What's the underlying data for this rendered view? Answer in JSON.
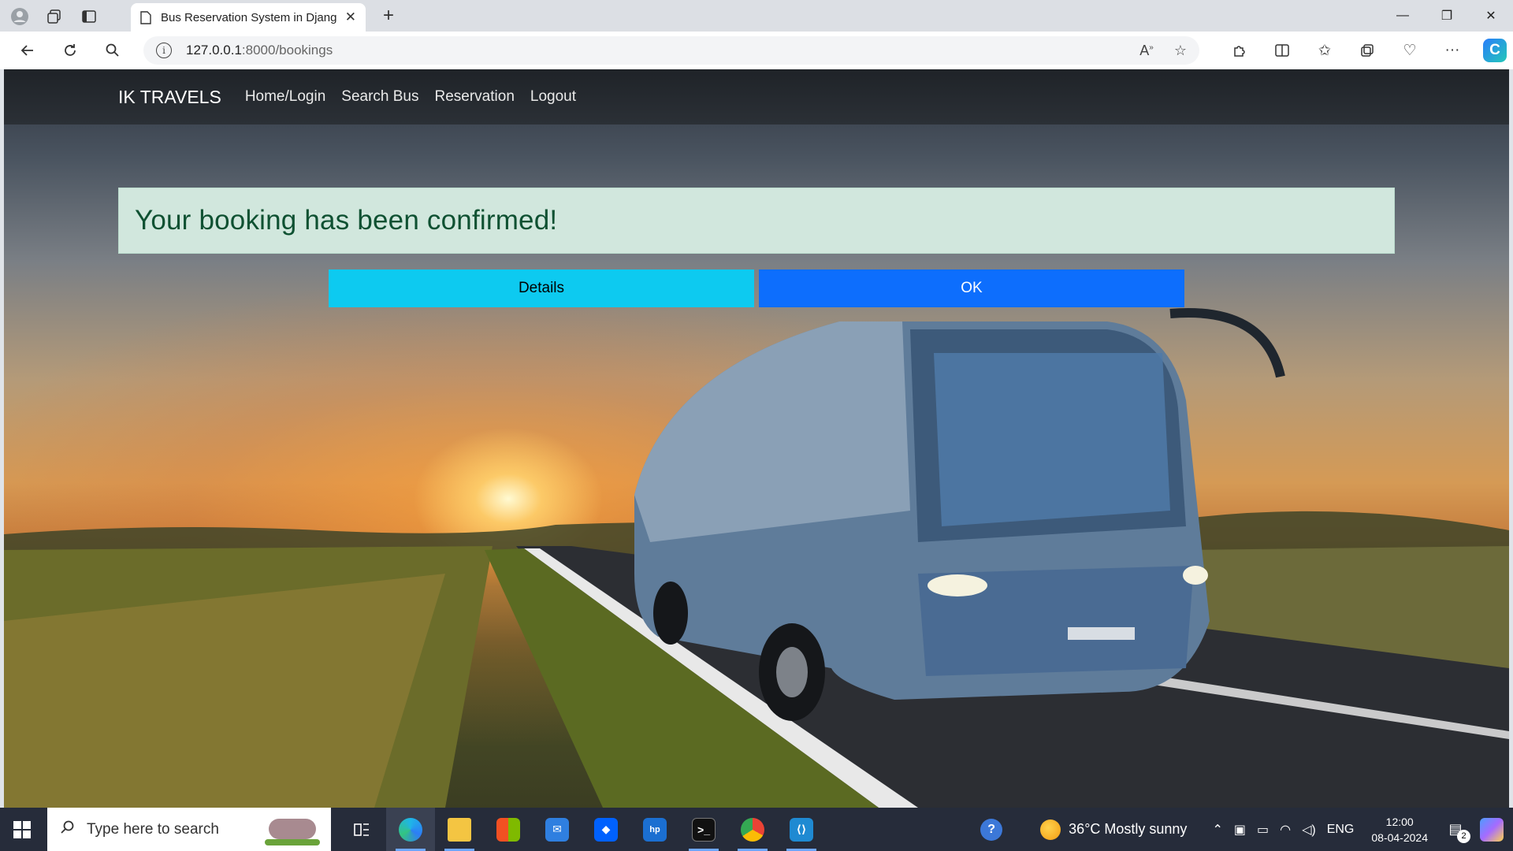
{
  "browser": {
    "tab_title": "Bus Reservation System in Djang",
    "url_host": "127.0.0.1",
    "url_path": ":8000/bookings",
    "icons": [
      "profile-icon",
      "workspaces-icon",
      "tab-actions-icon",
      "page-icon",
      "close-icon",
      "new-tab-icon",
      "minimize-icon",
      "restore-icon",
      "close-window-icon",
      "back-icon",
      "refresh-icon",
      "search-icon",
      "site-info-icon",
      "read-aloud-icon",
      "favorite-star-icon",
      "extensions-icon",
      "split-screen-icon",
      "favorites-icon",
      "collections-icon",
      "browser-essentials-icon",
      "more-icon",
      "copilot-icon"
    ]
  },
  "navbar": {
    "brand": "IK TRAVELS",
    "links": [
      "Home/Login",
      "Search Bus",
      "Reservation",
      "Logout"
    ]
  },
  "alert": {
    "message": "Your booking has been confirmed!",
    "color": "#0f5132",
    "background": "#d1e7dd"
  },
  "buttons": {
    "details": "Details",
    "ok": "OK",
    "details_color": "#0dcaf0",
    "ok_color": "#0d6efd"
  },
  "taskbar": {
    "search_placeholder": "Type here to search",
    "weather": "36°C  Mostly sunny",
    "language": "ENG",
    "time": "12:00",
    "date": "08-04-2024",
    "notification_count": "2",
    "apps": [
      "task-view-icon",
      "edge-icon",
      "file-explorer-icon",
      "microsoft-store-icon",
      "mail-icon",
      "dropbox-icon",
      "myhp-icon",
      "terminal-icon",
      "chrome-icon",
      "vscode-icon"
    ]
  }
}
